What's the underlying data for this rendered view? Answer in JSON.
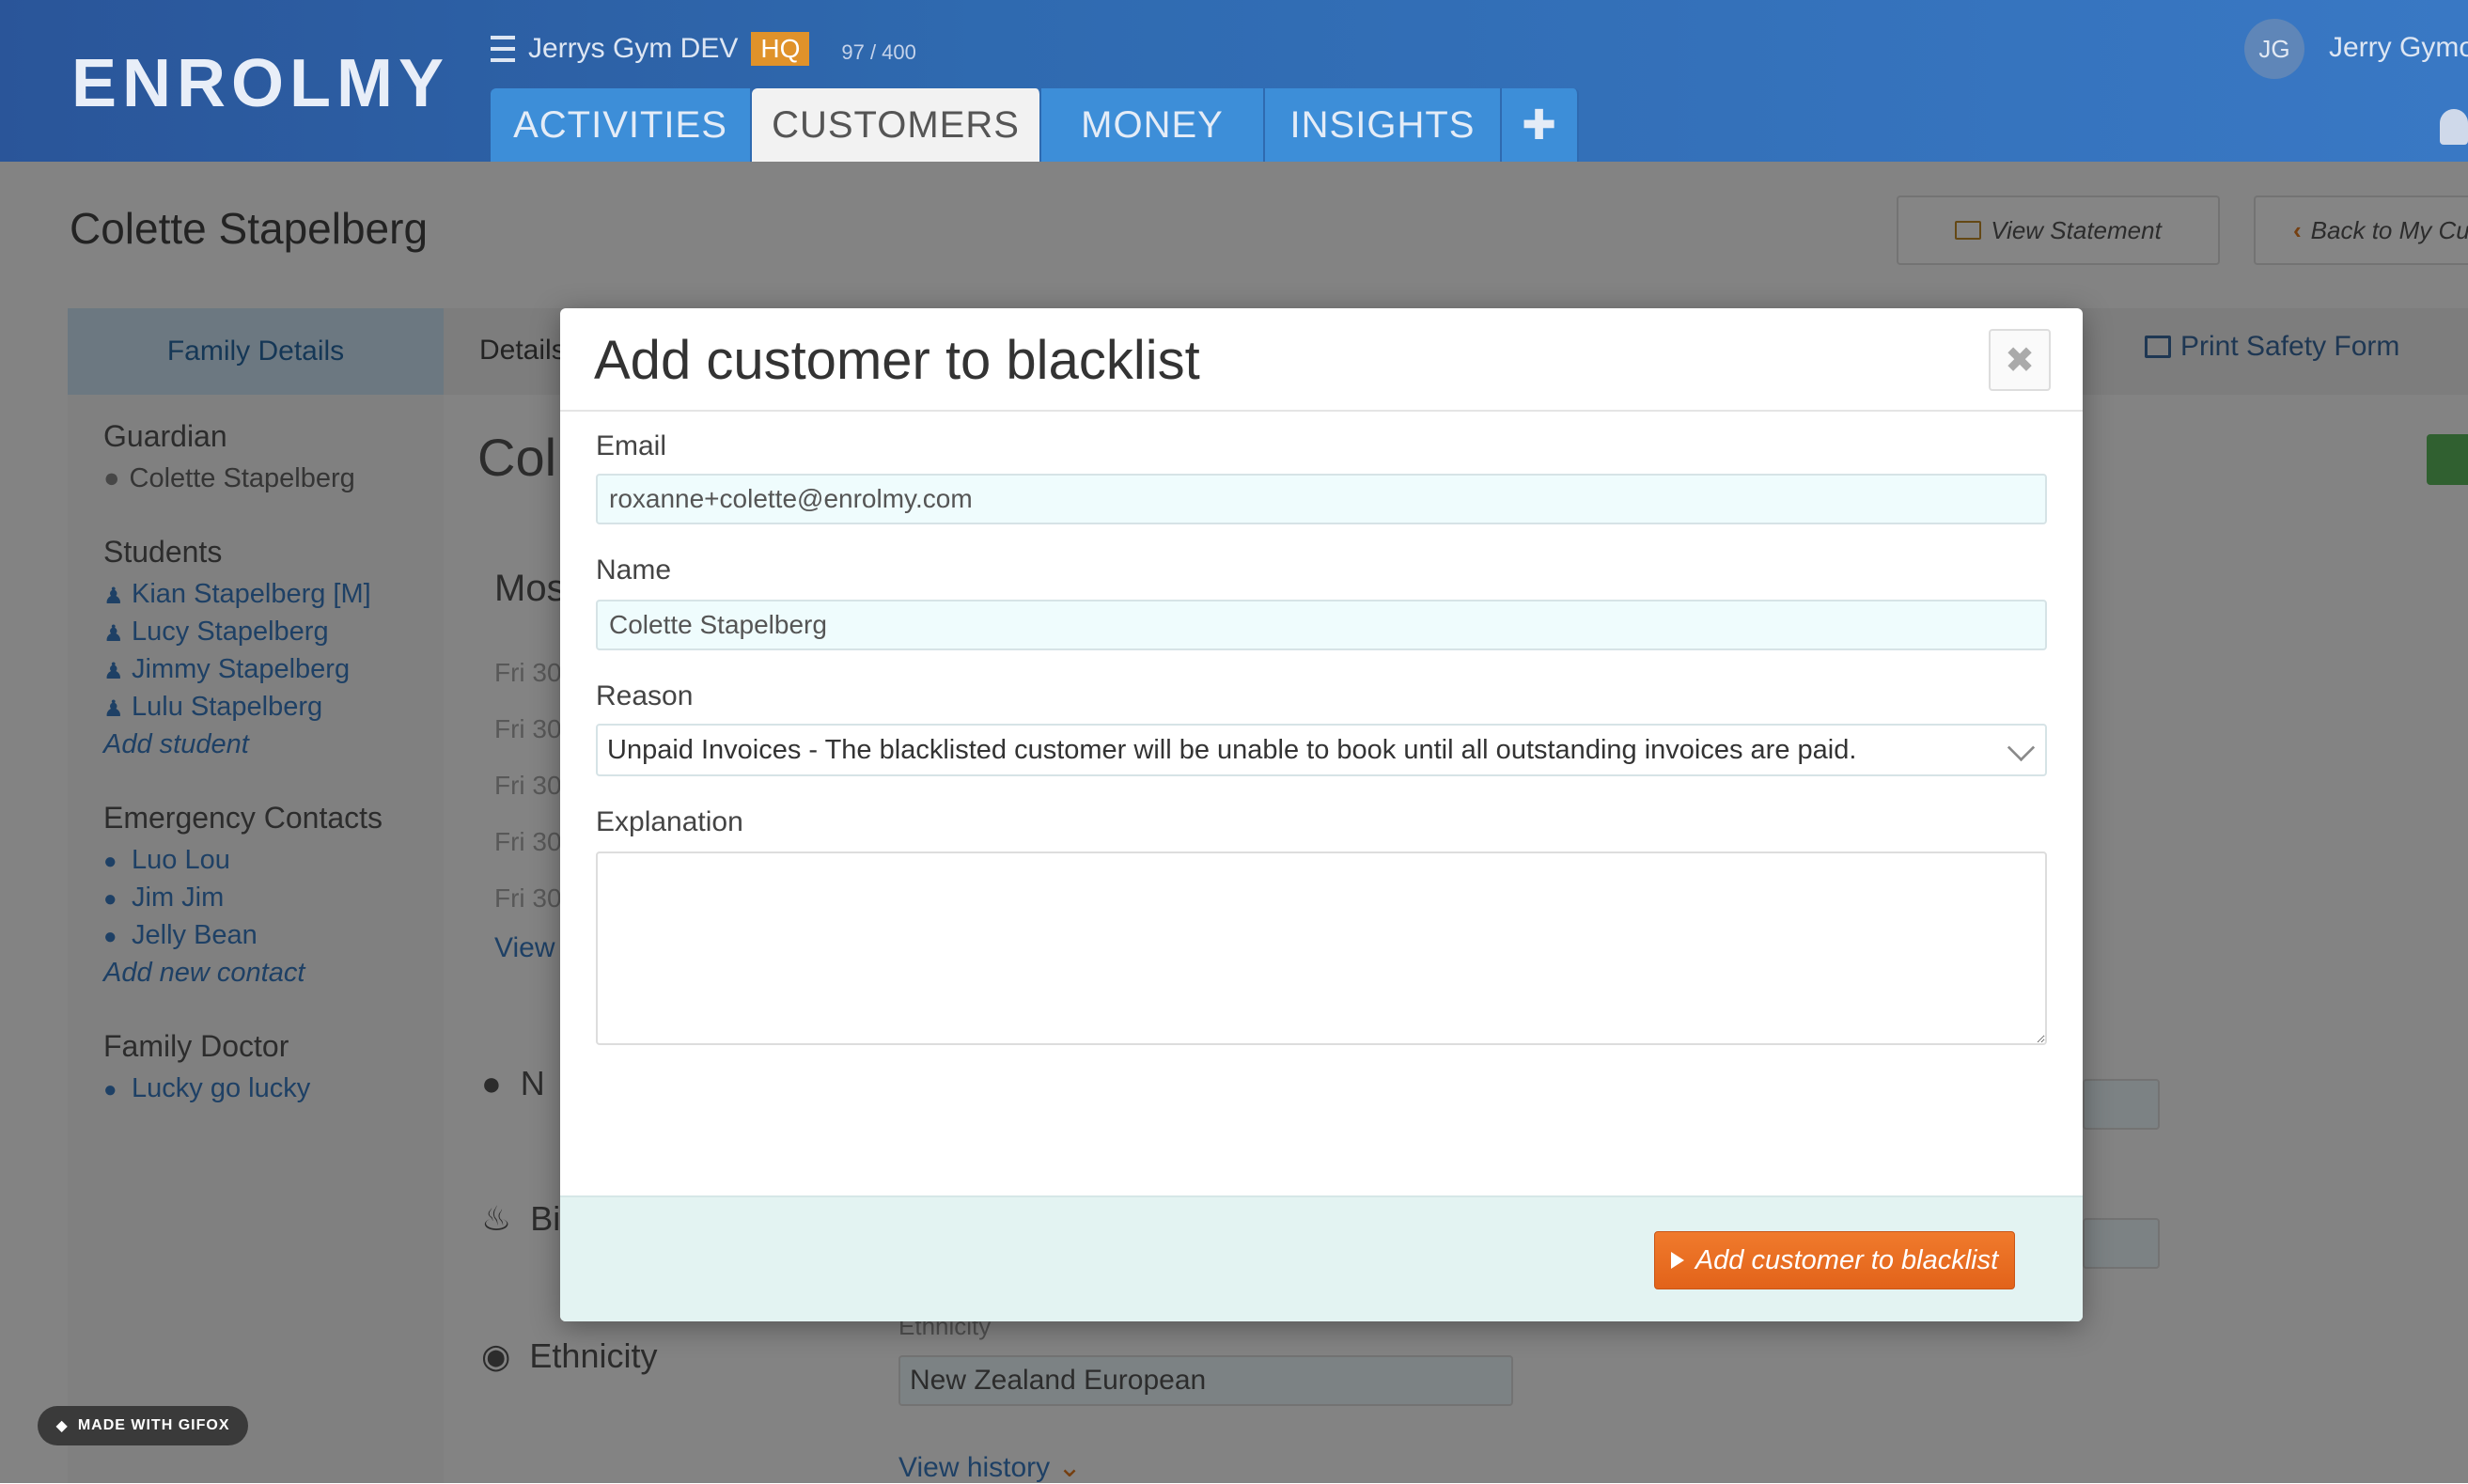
{
  "app": {
    "logo": "ENROLMY",
    "org_name": "Jerrys Gym DEV",
    "org_badge": "HQ",
    "usage": "97 / 400",
    "user_initials": "JG",
    "user_name": "Jerry Gymo"
  },
  "nav": {
    "tabs": [
      {
        "label": "ACTIVITIES",
        "active": false
      },
      {
        "label": "CUSTOMERS",
        "active": true
      },
      {
        "label": "MONEY",
        "active": false
      },
      {
        "label": "INSIGHTS",
        "active": false
      },
      {
        "label": "✚",
        "active": false
      }
    ]
  },
  "page": {
    "title": "Colette Stapelberg",
    "view_statement": "View Statement",
    "back": "Back to My Cust",
    "print_safety_form": "Print Safety Form",
    "details_tab": "Details",
    "heading_partial": "Col",
    "most_partial": "Mos",
    "rows": [
      "Fri 30",
      "Fri 30",
      "Fri 30",
      "Fri 30",
      "Fri 30"
    ],
    "view_partial": "View",
    "name_partial": "N",
    "birthday_partial": "Bi",
    "ethnicity_heading": "Ethnicity",
    "ethnicity_label": "Ethnicity",
    "ethnicity_value": "New Zealand European",
    "view_history": "View history"
  },
  "sidebar": {
    "header": "Family Details",
    "guardian_title": "Guardian",
    "guardian": "Colette Stapelberg",
    "students_title": "Students",
    "students": [
      "Kian Stapelberg [M]",
      "Lucy Stapelberg",
      "Jimmy Stapelberg",
      "Lulu Stapelberg"
    ],
    "add_student": "Add student",
    "contacts_title": "Emergency Contacts",
    "contacts": [
      "Luo Lou",
      "Jim Jim",
      "Jelly Bean"
    ],
    "add_contact": "Add new contact",
    "doctor_title": "Family Doctor",
    "doctor": "Lucky go lucky"
  },
  "modal": {
    "title": "Add customer to blacklist",
    "close": "✖",
    "email_label": "Email",
    "email_value": "roxanne+colette@enrolmy.com",
    "name_label": "Name",
    "name_value": "Colette Stapelberg",
    "reason_label": "Reason",
    "reason_value": "Unpaid Invoices - The blacklisted customer will be unable to book until all outstanding invoices are paid.",
    "explanation_label": "Explanation",
    "explanation_value": "",
    "submit_label": "Add customer to blacklist"
  },
  "watermark": "MADE WITH GIFOX"
}
